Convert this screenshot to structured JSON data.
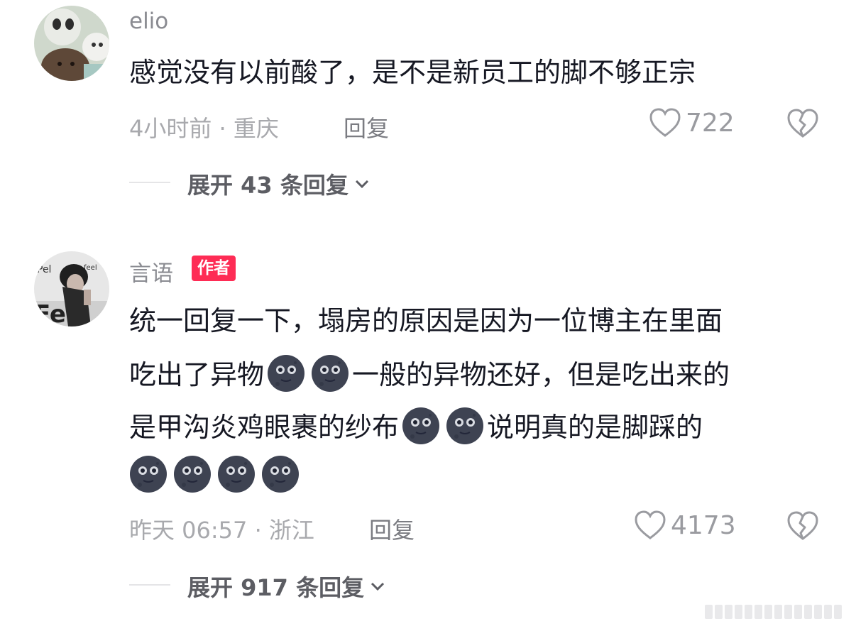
{
  "comments": [
    {
      "username": "elio",
      "text_lines": [
        "感觉没有以前酸了，是不是新员工的脚不够正宗"
      ],
      "time_location": "4小时前 · 重庆",
      "reply_label": "回复",
      "likes": "722",
      "expand_label": "展开 43 条回复"
    },
    {
      "username": "言语",
      "author_badge": "作者",
      "line1": "统一回复一下，塌房的原因是因为一位博主在里面",
      "line2_a": "吃出了异物",
      "line2_b": "一般的异物还好，但是吃出来的",
      "line3_a": "是甲沟炎鸡眼裹的纱布",
      "line3_b": "说明真的是脚踩的",
      "time_location": "昨天 06:57 · 浙江",
      "reply_label": "回复",
      "likes": "4173",
      "expand_label": "展开 917 条回复"
    }
  ],
  "icons": {
    "like": "heart-outline-icon",
    "dislike": "broken-heart-icon",
    "expand": "chevron-down-icon",
    "emoji": "dark-moon-face-emoji"
  },
  "colors": {
    "author_badge": "#fe2c55",
    "meta_text": "#a8a9ad"
  }
}
